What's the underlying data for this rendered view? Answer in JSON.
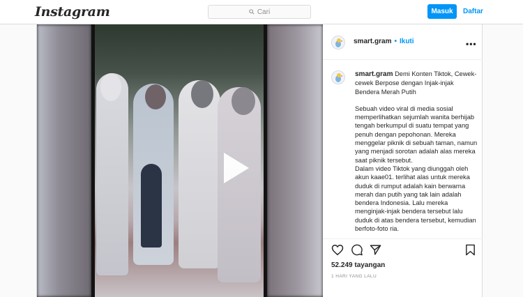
{
  "header": {
    "logo": "Instagram",
    "search_placeholder": "Cari",
    "login_label": "Masuk",
    "signup_label": "Daftar"
  },
  "post": {
    "username": "smart.gram",
    "follow_label": "Ikuti",
    "separator": "•",
    "more_icon": "more-horizontal-icon",
    "caption_title": "Demi Konten Tiktok, Cewek-cewek Berpose dengan Injak-injak Bendera Merah Putih",
    "caption_paragraphs": [
      "Sebuah video viral di media sosial memperlihatkan sejumlah wanita berhijab tengah berkumpul di suatu tempat yang penuh dengan pepohonan. Mereka menggelar piknik di sebuah taman, namun yang menjadi sorotan adalah alas mereka saat piknik tersebut.",
      "Dalam video Tiktok yang diunggah oleh akun kaae01. terlihat alas untuk mereka duduk di rumput adalah kain berwarna merah dan putih yang tak lain adalah bendera Indonesia. Lalu mereka menginjak-injak bendera tersebut lalu duduk di atas bendera tersebut, kemudian berfoto-foto ria."
    ],
    "views": "52.249 tayangan",
    "timestamp": "1 HARI YANG LALU",
    "colors": {
      "accent": "#0095f6",
      "text": "#262626",
      "muted": "#8e8e8e"
    }
  }
}
